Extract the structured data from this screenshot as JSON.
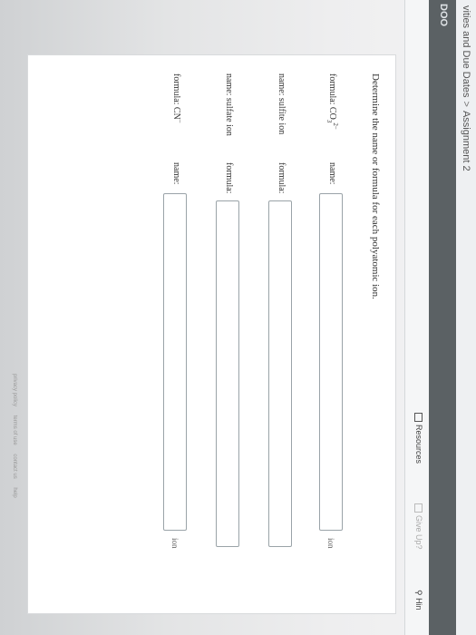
{
  "breadcrumb": {
    "parent": "vities and Due Dates",
    "separator": ">",
    "current": "Assignment 2"
  },
  "nav": {
    "logo_text": "DOO"
  },
  "toolbar": {
    "resources_label": "Resources",
    "give_up_label": "Give Up?",
    "hint_label": "Hin"
  },
  "question": {
    "prompt": "Determine the name or formula for each polyatomic ion.",
    "rows": [
      {
        "given_label": "formula: CO",
        "given_sup": "2−",
        "given_sub": "3",
        "answer_label": "name:",
        "suffix": "ion",
        "value": ""
      },
      {
        "given_label": "name: sulfite ion",
        "answer_label": "formula:",
        "suffix": "",
        "value": ""
      },
      {
        "given_label": "name: sulfate ion",
        "answer_label": "formula:",
        "suffix": "",
        "value": ""
      },
      {
        "given_label": "formula: CN",
        "given_sup": "−",
        "answer_label": "name:",
        "suffix": "ion",
        "value": ""
      }
    ]
  },
  "footer": {
    "links": [
      "privacy policy",
      "terms of use",
      "contact us",
      "help"
    ]
  },
  "colors": {
    "topbar": "#eef0f2",
    "navbar": "#5b6164",
    "field_border": "#9aa3a8"
  }
}
